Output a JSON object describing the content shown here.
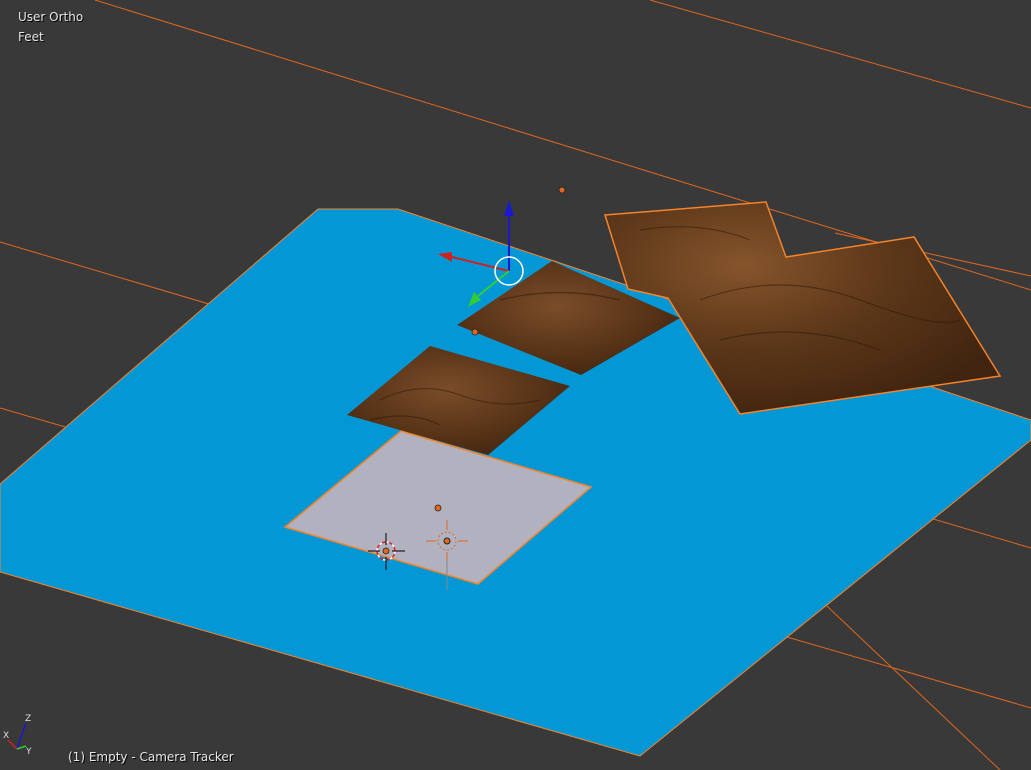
{
  "viewport": {
    "view_name": "User Ortho",
    "units": "Feet",
    "object_info": "(1) Empty - Camera Tracker"
  },
  "axis_gizmo": {
    "labels": [
      "Z",
      "X",
      "Y"
    ]
  },
  "colors": {
    "background": "#393939",
    "water_plane": "#0398d5",
    "selected_outline": "#f5832a",
    "terrain": "#5a3518",
    "light_plane": "#b1b1bf",
    "gizmo_x": "#cc2222",
    "gizmo_y": "#33cc33",
    "gizmo_z": "#1a1acc"
  }
}
